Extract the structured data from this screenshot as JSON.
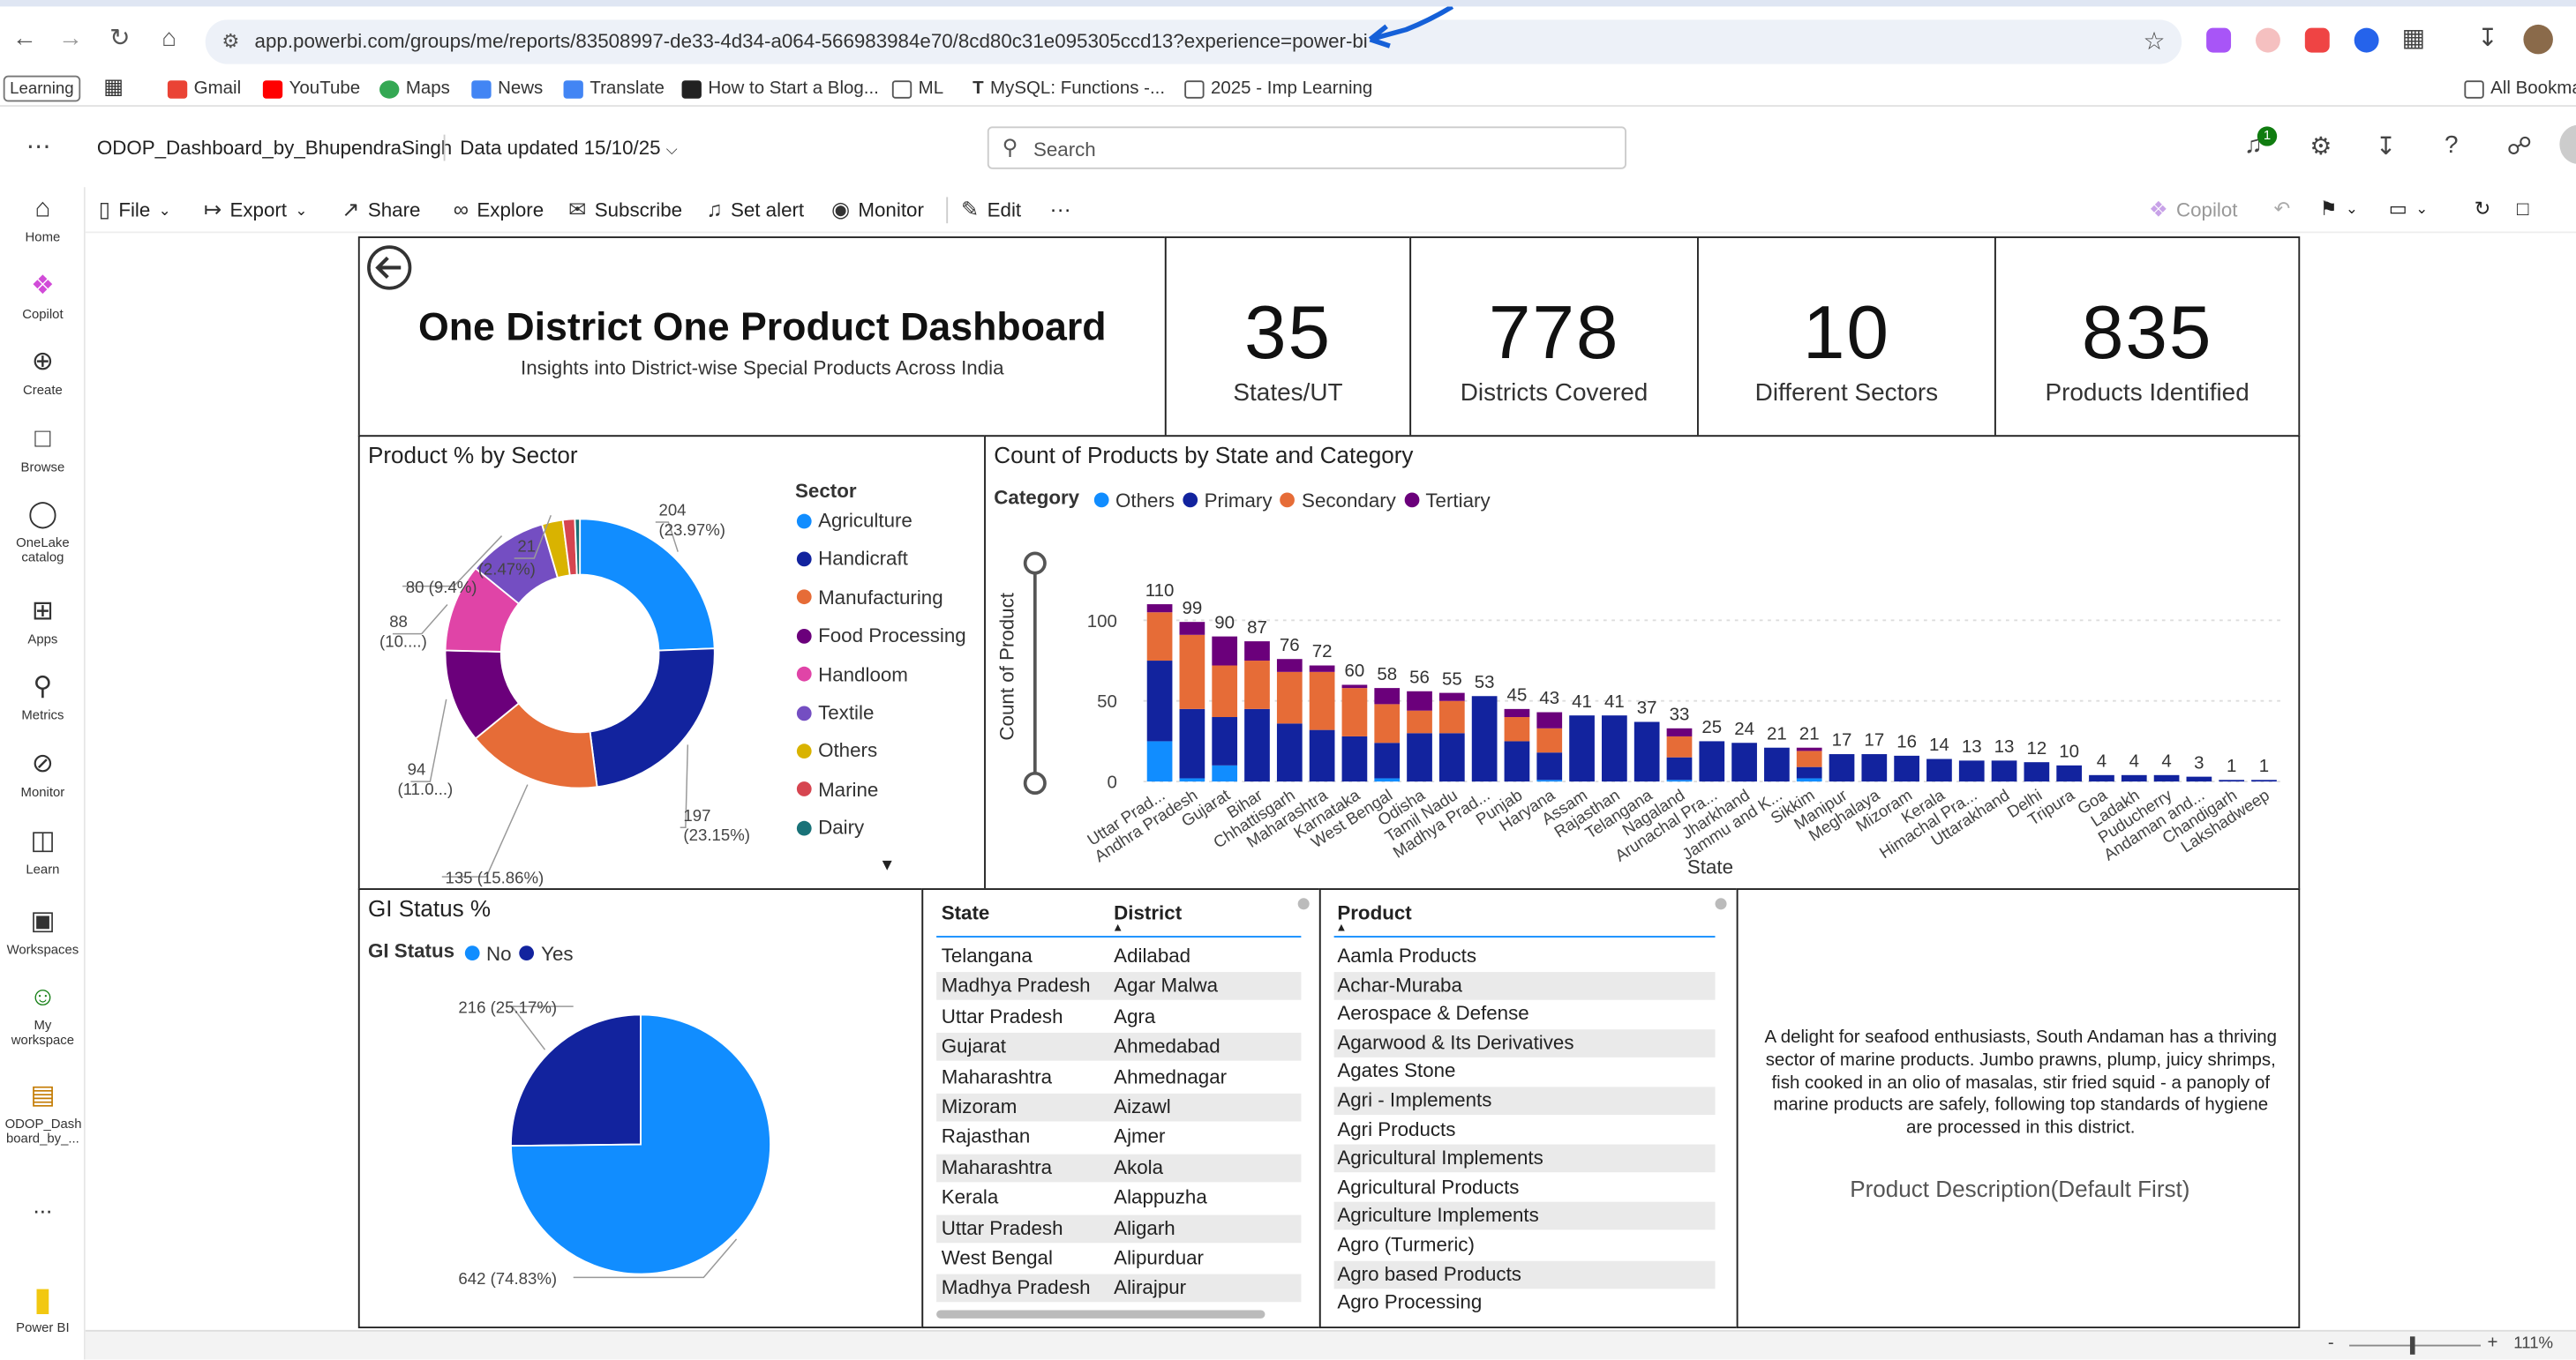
{
  "browser": {
    "url": "app.powerbi.com/groups/me/reports/83508997-de33-4d34-a064-566983984e70/8cd80c31e095305ccd13?experience=power-bi",
    "bookmarks": [
      "Learning",
      "Gmail",
      "YouTube",
      "Maps",
      "News",
      "Translate",
      "How to Start a Blog...",
      "ML",
      "MySQL: Functions -...",
      "2025 - Imp Learning"
    ],
    "all_bookmarks": "All Bookma"
  },
  "pbi": {
    "report_name": "ODOP_Dashboard_by_BhupendraSingh",
    "data_updated": "Data updated 15/10/25",
    "search_placeholder": "Search",
    "notification_count": "1",
    "rail": [
      "Home",
      "Copilot",
      "Create",
      "Browse",
      "OneLake catalog",
      "Apps",
      "Metrics",
      "Monitor",
      "Learn",
      "Workspaces",
      "My workspace",
      "ODOP_Dash board_by_..."
    ],
    "rail_more": "...",
    "brand": "Power BI",
    "toolbar": {
      "file": "File",
      "export": "Export",
      "share": "Share",
      "explore": "Explore",
      "subscribe": "Subscribe",
      "set_alert": "Set alert",
      "monitor": "Monitor",
      "edit": "Edit",
      "more": "···",
      "copilot": "Copilot"
    },
    "zoom": "111%",
    "zoom_minus": "-",
    "zoom_plus": "+"
  },
  "report": {
    "title": "One District One Product Dashboard",
    "subtitle": "Insights into District-wise Special Products Across India",
    "kpis": [
      {
        "value": "35",
        "label": "States/UT"
      },
      {
        "value": "778",
        "label": "Districts Covered"
      },
      {
        "value": "10",
        "label": "Different Sectors"
      },
      {
        "value": "835",
        "label": "Products Identified"
      }
    ],
    "donut_title": "Product % by Sector",
    "donut_legend_title": "Sector",
    "bar_title": "Count of Products by State and Category",
    "bar_legend_title": "Category",
    "gi_title": "GI Status %",
    "gi_legend_title": "GI Status",
    "state_district_table": {
      "headers": [
        "State",
        "District"
      ],
      "rows": [
        [
          "Telangana",
          "Adilabad"
        ],
        [
          "Madhya Pradesh",
          "Agar Malwa"
        ],
        [
          "Uttar Pradesh",
          "Agra"
        ],
        [
          "Gujarat",
          "Ahmedabad"
        ],
        [
          "Maharashtra",
          "Ahmednagar"
        ],
        [
          "Mizoram",
          "Aizawl"
        ],
        [
          "Rajasthan",
          "Ajmer"
        ],
        [
          "Maharashtra",
          "Akola"
        ],
        [
          "Kerala",
          "Alappuzha"
        ],
        [
          "Uttar Pradesh",
          "Aligarh"
        ],
        [
          "West Bengal",
          "Alipurduar"
        ],
        [
          "Madhya Pradesh",
          "Alirajpur"
        ]
      ]
    },
    "product_table": {
      "header": "Product",
      "rows": [
        "Aamla Products",
        "Achar-Muraba",
        "Aerospace & Defense",
        "Agarwood & Its Derivatives",
        "Agates Stone",
        "Agri - Implements",
        "Agri Products",
        "Agricultural Implements",
        "Agricultural Products",
        "Agriculture Implements",
        "Agro (Turmeric)",
        "Agro based Products",
        "Agro Processing"
      ]
    },
    "description": "A delight for seafood enthusiasts, South Andaman has a thriving sector of marine products. Jumbo prawns, plump, juicy shrimps, fish cooked in an olio of masalas, stir fried squid - a panoply of marine products are safely, following top standards of hygiene are processed in this district.",
    "description_label": "Product Description(Default First)"
  },
  "colors": {
    "Agriculture": "#118dff",
    "Handicraft": "#12239e",
    "Manufacturing": "#e66c37",
    "Food Processing": "#6b007b",
    "Handloom": "#e044a7",
    "Textile": "#744ec2",
    "Others": "#d9b300",
    "Marine": "#d64550",
    "Dairy": "#197278"
  },
  "chart_data": [
    {
      "type": "pie",
      "title": "Product % by Sector",
      "legend_title": "Sector",
      "categories": [
        "Agriculture",
        "Handicraft",
        "Manufacturing",
        "Food Processing",
        "Handloom",
        "Textile",
        "Others",
        "Marine",
        "Dairy"
      ],
      "values": [
        204,
        197,
        135,
        94,
        88,
        80,
        21,
        12,
        5
      ],
      "labels": [
        "204 (23.97%)",
        "197 (23.15%)",
        "135 (15.86%)",
        "94 (11.0...)",
        "88 (10....)",
        "80 (9.4%)",
        "21 (2.47%)",
        "",
        ""
      ],
      "label_parts": {
        "204 (23.97%)": [
          "204",
          "(23.97%)"
        ],
        "197 (23.15%)": [
          "197",
          "(23.15%)"
        ],
        "94 (11.0...)": [
          "94",
          "(11.0...)"
        ],
        "88 (10....)": [
          "88",
          "(10....)"
        ],
        "21 (2.47%)": [
          "21",
          "(2.47%)"
        ]
      },
      "donut": true
    },
    {
      "type": "bar",
      "stacked": true,
      "title": "Count of Products by State and Category",
      "xlabel": "State",
      "ylabel": "Count of Product",
      "ylim": [
        0,
        110
      ],
      "yticks": [
        0,
        50,
        100
      ],
      "legend_title": "Category",
      "categories": [
        "Uttar Prad...",
        "Andhra Pradesh",
        "Gujarat",
        "Bihar",
        "Chhattisgarh",
        "Maharashtra",
        "Karnataka",
        "West Bengal",
        "Odisha",
        "Tamil Nadu",
        "Madhya Prad...",
        "Punjab",
        "Haryana",
        "Assam",
        "Rajasthan",
        "Telangana",
        "Nagaland",
        "Arunachal Pra...",
        "Jharkhand",
        "Jammu and K...",
        "Sikkim",
        "Manipur",
        "Meghalaya",
        "Mizoram",
        "Kerala",
        "Himachal Pra...",
        "Uttarakhand",
        "Delhi",
        "Tripura",
        "Goa",
        "Ladakh",
        "Puducherry",
        "Andaman and...",
        "Chandigarh",
        "Lakshadweep"
      ],
      "totals": [
        110,
        99,
        90,
        87,
        76,
        72,
        60,
        58,
        56,
        55,
        53,
        45,
        43,
        41,
        41,
        37,
        33,
        25,
        24,
        21,
        21,
        17,
        17,
        16,
        14,
        13,
        13,
        12,
        10,
        4,
        4,
        4,
        3,
        1,
        1
      ],
      "series": [
        {
          "name": "Others",
          "color": "#118dff",
          "values": [
            25,
            2,
            10,
            0,
            0,
            0,
            0,
            2,
            0,
            0,
            0,
            0,
            1,
            0,
            0,
            0,
            1,
            0,
            0,
            0,
            2,
            0,
            0,
            0,
            0,
            0,
            0,
            0,
            0,
            0,
            0,
            0,
            0,
            0,
            0
          ]
        },
        {
          "name": "Primary",
          "color": "#12239e",
          "values": [
            50,
            43,
            30,
            45,
            36,
            32,
            28,
            22,
            30,
            30,
            53,
            25,
            17,
            41,
            41,
            37,
            14,
            25,
            24,
            21,
            7,
            17,
            17,
            16,
            14,
            13,
            13,
            12,
            10,
            4,
            4,
            4,
            3,
            1,
            1
          ]
        },
        {
          "name": "Secondary",
          "color": "#e66c37",
          "values": [
            30,
            46,
            32,
            30,
            32,
            36,
            30,
            24,
            14,
            20,
            0,
            15,
            15,
            0,
            0,
            0,
            13,
            0,
            0,
            0,
            10,
            0,
            0,
            0,
            0,
            0,
            0,
            0,
            0,
            0,
            0,
            0,
            0,
            0,
            0
          ]
        },
        {
          "name": "Tertiary",
          "color": "#6b007b",
          "values": [
            5,
            8,
            18,
            12,
            8,
            4,
            2,
            10,
            12,
            5,
            0,
            5,
            10,
            0,
            0,
            0,
            5,
            0,
            0,
            0,
            2,
            0,
            0,
            0,
            0,
            0,
            0,
            0,
            0,
            0,
            0,
            0,
            0,
            0,
            0
          ]
        }
      ]
    },
    {
      "type": "pie",
      "title": "GI Status %",
      "legend_title": "GI Status",
      "categories": [
        "No",
        "Yes"
      ],
      "values": [
        642,
        216
      ],
      "labels": [
        "642 (74.83%)",
        "216 (25.17%)"
      ],
      "colors": [
        "#118dff",
        "#12239e"
      ]
    }
  ]
}
